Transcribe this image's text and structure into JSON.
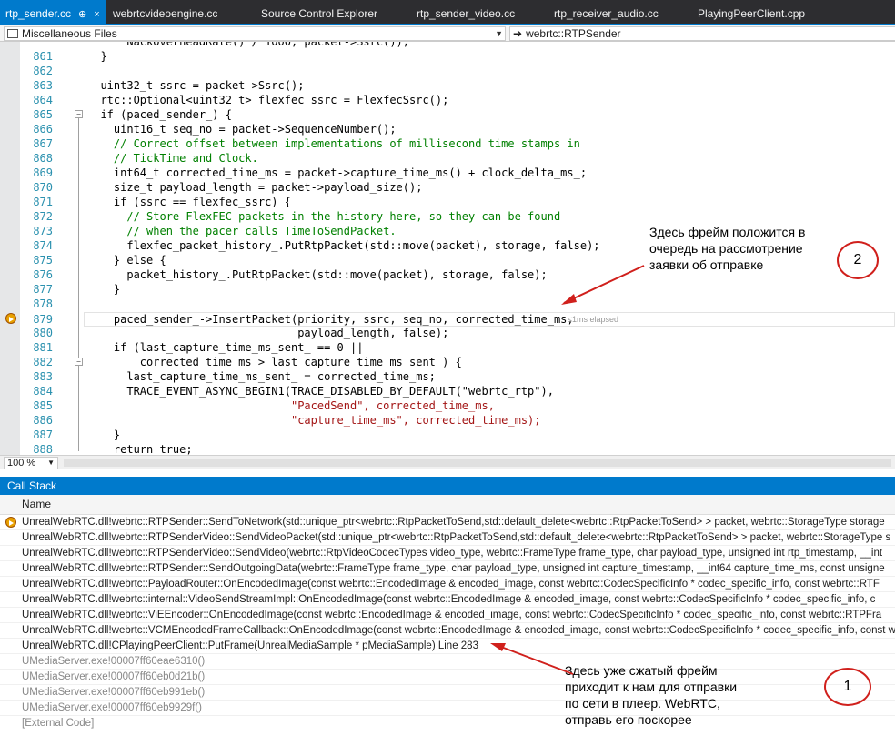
{
  "tabs": [
    {
      "label": "rtp_sender.cc",
      "active": true,
      "pin": "⊕",
      "close": "×"
    },
    {
      "label": "webrtcvideoengine.cc"
    },
    {
      "label": "Source Control Explorer"
    },
    {
      "label": "rtp_sender_video.cc"
    },
    {
      "label": "rtp_receiver_audio.cc"
    },
    {
      "label": "PlayingPeerClient.cpp"
    }
  ],
  "nav": {
    "project": "Miscellaneous Files",
    "scope": "webrtc::RTPSender"
  },
  "editor": {
    "current_line": 879,
    "elapsed": "≤1ms elapsed",
    "lines": [
      {
        "num": "",
        "text": "      NackOverheadRate() / 1000, packet->Ssrc());"
      },
      {
        "num": "861",
        "text": "  }"
      },
      {
        "num": "862",
        "text": ""
      },
      {
        "num": "863",
        "text": "  uint32_t ssrc = packet->Ssrc();"
      },
      {
        "num": "864",
        "text": "  rtc::Optional<uint32_t> flexfec_ssrc = FlexfecSsrc();"
      },
      {
        "num": "865",
        "text": "  if (paced_sender_) {"
      },
      {
        "num": "866",
        "text": "    uint16_t seq_no = packet->SequenceNumber();"
      },
      {
        "num": "867",
        "text": "    // Correct offset between implementations of millisecond time stamps in"
      },
      {
        "num": "868",
        "text": "    // TickTime and Clock."
      },
      {
        "num": "869",
        "text": "    int64_t corrected_time_ms = packet->capture_time_ms() + clock_delta_ms_;"
      },
      {
        "num": "870",
        "text": "    size_t payload_length = packet->payload_size();"
      },
      {
        "num": "871",
        "text": "    if (ssrc == flexfec_ssrc) {"
      },
      {
        "num": "872",
        "text": "      // Store FlexFEC packets in the history here, so they can be found"
      },
      {
        "num": "873",
        "text": "      // when the pacer calls TimeToSendPacket."
      },
      {
        "num": "874",
        "text": "      flexfec_packet_history_.PutRtpPacket(std::move(packet), storage, false);"
      },
      {
        "num": "875",
        "text": "    } else {"
      },
      {
        "num": "876",
        "text": "      packet_history_.PutRtpPacket(std::move(packet), storage, false);"
      },
      {
        "num": "877",
        "text": "    }"
      },
      {
        "num": "878",
        "text": ""
      },
      {
        "num": "879",
        "text": "    paced_sender_->InsertPacket(priority, ssrc, seq_no, corrected_time_ms,"
      },
      {
        "num": "880",
        "text": "                                payload_length, false);"
      },
      {
        "num": "881",
        "text": "    if (last_capture_time_ms_sent_ == 0 ||"
      },
      {
        "num": "882",
        "text": "        corrected_time_ms > last_capture_time_ms_sent_) {"
      },
      {
        "num": "883",
        "text": "      last_capture_time_ms_sent_ = corrected_time_ms;"
      },
      {
        "num": "884",
        "text": "      TRACE_EVENT_ASYNC_BEGIN1(TRACE_DISABLED_BY_DEFAULT(\"webrtc_rtp\"),"
      },
      {
        "num": "885",
        "text": "                               \"PacedSend\", corrected_time_ms,"
      },
      {
        "num": "886",
        "text": "                               \"capture_time_ms\", corrected_time_ms);"
      },
      {
        "num": "887",
        "text": "    }"
      },
      {
        "num": "888",
        "text": "    return true;"
      }
    ]
  },
  "zoom": "100 %",
  "callstack": {
    "title": "Call Stack",
    "column": "Name",
    "rows": [
      {
        "text": "UnrealWebRTC.dll!webrtc::RTPSender::SendToNetwork(std::unique_ptr<webrtc::RtpPacketToSend,std::default_delete<webrtc::RtpPacketToSend> > packet, webrtc::StorageType storage",
        "current": true
      },
      {
        "text": "UnrealWebRTC.dll!webrtc::RTPSenderVideo::SendVideoPacket(std::unique_ptr<webrtc::RtpPacketToSend,std::default_delete<webrtc::RtpPacketToSend> > packet, webrtc::StorageType s"
      },
      {
        "text": "UnrealWebRTC.dll!webrtc::RTPSenderVideo::SendVideo(webrtc::RtpVideoCodecTypes video_type, webrtc::FrameType frame_type, char payload_type, unsigned int rtp_timestamp, __int"
      },
      {
        "text": "UnrealWebRTC.dll!webrtc::RTPSender::SendOutgoingData(webrtc::FrameType frame_type, char payload_type, unsigned int capture_timestamp, __int64 capture_time_ms, const unsigne"
      },
      {
        "text": "UnrealWebRTC.dll!webrtc::PayloadRouter::OnEncodedImage(const webrtc::EncodedImage & encoded_image, const webrtc::CodecSpecificInfo * codec_specific_info, const webrtc::RTF"
      },
      {
        "text": "UnrealWebRTC.dll!webrtc::internal::VideoSendStreamImpl::OnEncodedImage(const webrtc::EncodedImage & encoded_image, const webrtc::CodecSpecificInfo * codec_specific_info, c"
      },
      {
        "text": "UnrealWebRTC.dll!webrtc::ViEEncoder::OnEncodedImage(const webrtc::EncodedImage & encoded_image, const webrtc::CodecSpecificInfo * codec_specific_info, const webrtc::RTPFra"
      },
      {
        "text": "UnrealWebRTC.dll!webrtc::VCMEncodedFrameCallback::OnEncodedImage(const webrtc::EncodedImage & encoded_image, const webrtc::CodecSpecificInfo * codec_specific_info, const w"
      },
      {
        "text": "UnrealWebRTC.dll!CPlayingPeerClient::PutFrame(UnrealMediaSample * pMediaSample) Line 283"
      },
      {
        "text": "UMediaServer.exe!00007ff60eae6310()",
        "gray": true
      },
      {
        "text": "UMediaServer.exe!00007ff60eb0d21b()",
        "gray": true
      },
      {
        "text": "UMediaServer.exe!00007ff60eb991eb()",
        "gray": true
      },
      {
        "text": "UMediaServer.exe!00007ff60eb9929f()",
        "gray": true
      },
      {
        "text": "[External Code]",
        "gray": true
      }
    ]
  },
  "annotations": {
    "top_text": "Здесь фрейм положится в\nочередь на рассмотрение\nзаявки об отправке",
    "top_number": "2",
    "bottom_text": "Здесь уже сжатый фрейм\nприходит к нам для отправки\nпо сети в плеер. WebRTC,\nотправь его поскорее",
    "bottom_number": "1",
    "color": "#d0201c"
  }
}
